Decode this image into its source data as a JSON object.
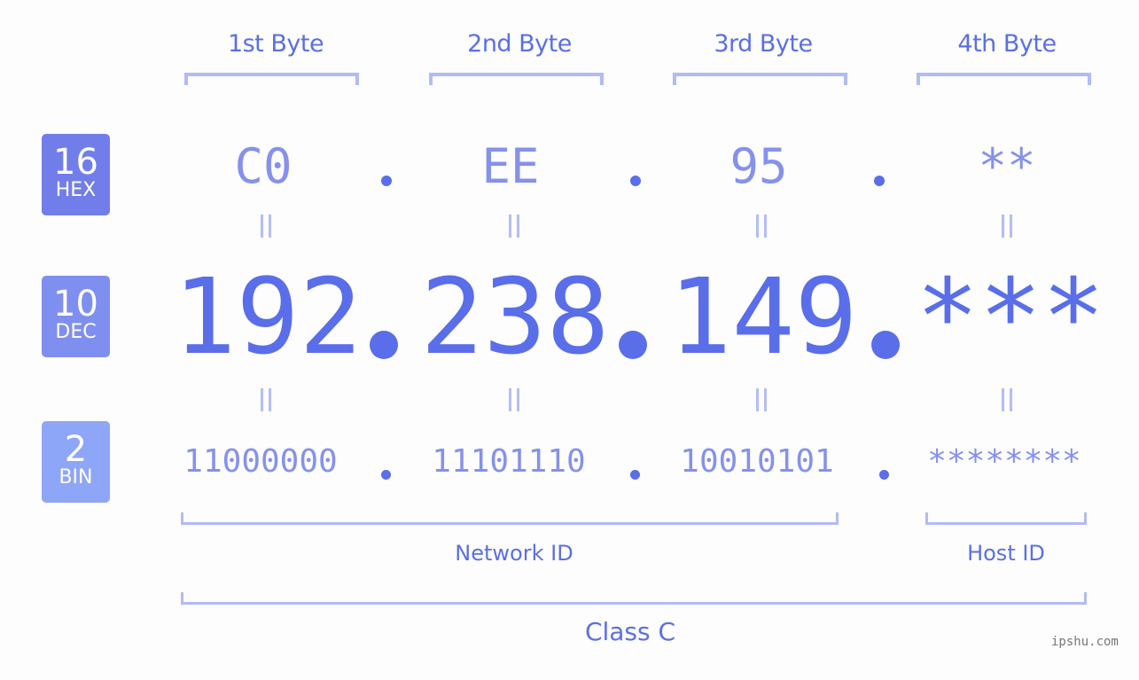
{
  "byte_headers": [
    "1st Byte",
    "2nd Byte",
    "3rd Byte",
    "4th Byte"
  ],
  "badges": {
    "hex": {
      "number": "16",
      "label": "HEX",
      "color": "#717ee9"
    },
    "dec": {
      "number": "10",
      "label": "DEC",
      "color": "#7f8fef"
    },
    "bin": {
      "number": "2",
      "label": "BIN",
      "color": "#8ea6f8"
    }
  },
  "ip": {
    "hex": [
      "C0",
      "EE",
      "95",
      "**"
    ],
    "dec": [
      "192",
      "238",
      "149",
      "***"
    ],
    "bin": [
      "11000000",
      "11101110",
      "10010101",
      "********"
    ],
    "equals_sign": "="
  },
  "sections": {
    "network_id": "Network ID",
    "host_id": "Host ID",
    "class": "Class C"
  },
  "colors": {
    "accent": "#5a6ee9",
    "light_accent": "#8591ec",
    "bracket": "#b1bbf6",
    "background": "#fcfdfc"
  },
  "watermark": "ipshu.com"
}
